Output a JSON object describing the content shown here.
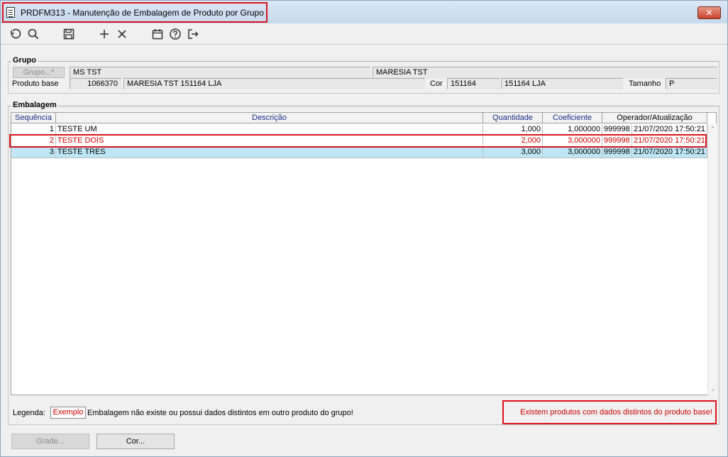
{
  "window": {
    "title": "PRDFM313 - Manutenção de Embalagem de Produto por Grupo",
    "close_label": "✕"
  },
  "toolbar": {
    "undo_icon": "undo-icon",
    "search_icon": "search-icon",
    "save_icon": "save-icon",
    "add_icon": "add-icon",
    "delete_icon": "delete-icon",
    "calendar_icon": "calendar-icon",
    "help_icon": "help-icon",
    "exit_icon": "exit-icon"
  },
  "grupo": {
    "section_title": "Grupo",
    "grupo_button": "Grupo...*",
    "grupo_value": "MS TST",
    "grupo_description": "MARESIA TST",
    "produto_label": "Produto base",
    "produto_code": "1066370",
    "produto_description": "MARESIA TST 151164 LJA",
    "cor_label": "Cor",
    "cor_code": "151164",
    "cor_description": "151164 LJA",
    "tamanho_label": "Tamanho",
    "tamanho_value": "P"
  },
  "embalagem": {
    "section_title": "Embalagem",
    "columns": [
      "Sequência",
      "Descrição",
      "Quantidade",
      "Coeficiente",
      "Operador/Atualização"
    ],
    "rows": [
      {
        "seq": "1",
        "desc": "TESTE UM",
        "qtd": "1,000",
        "coef": "1,000000",
        "oper": "999998",
        "date": "21/07/2020 17:50:21"
      },
      {
        "seq": "2",
        "desc": "TESTE DOIS",
        "qtd": "2,000",
        "coef": "3,000000",
        "oper": "999998",
        "date": "21/07/2020 17:50:21"
      },
      {
        "seq": "3",
        "desc": "TESTE TRES",
        "qtd": "3,000",
        "coef": "3,000000",
        "oper": "999998",
        "date": "21/07/2020 17:50:21"
      }
    ]
  },
  "legend": {
    "label": "Legenda:",
    "example": "Exemplo",
    "text": "Embalagem não existe ou possui dados distintos em outro produto do grupo!",
    "warning": "Existem produtos com dados distintos do produto base!"
  },
  "buttons": {
    "grade": "Grade...",
    "cor": "Cor..."
  },
  "colors": {
    "highlight": "#d9141b",
    "red_text": "#d00000",
    "selected_row": "#bfe6f6"
  }
}
